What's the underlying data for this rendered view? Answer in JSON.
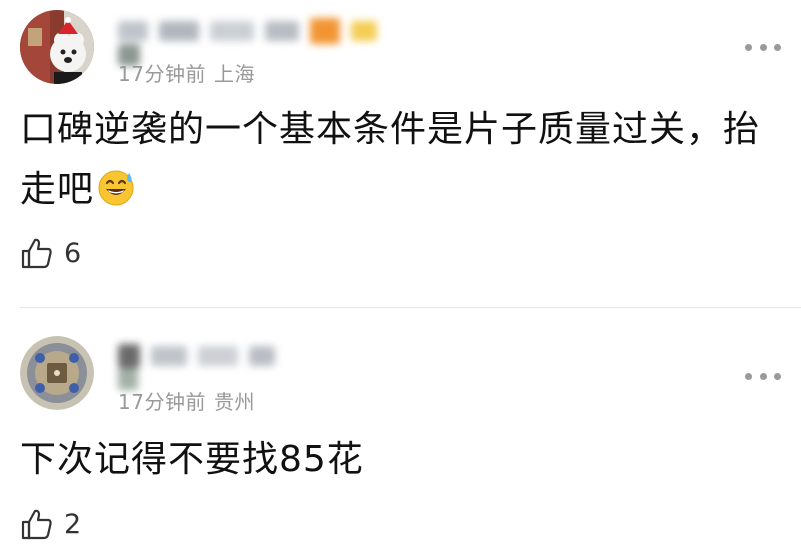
{
  "comments": [
    {
      "time": "17分钟前",
      "location": "上海",
      "text": "口碑逆袭的一个基本条件是片子质量过关，抬走吧",
      "emoji": "sweat-smile-emoji",
      "likes": "6"
    },
    {
      "time": "17分钟前",
      "location": "贵州",
      "text": "下次记得不要找85花",
      "likes": "2"
    }
  ],
  "icons": {
    "like": "thumbs-up-icon",
    "more": "more-dots-icon"
  },
  "colors": {
    "meta_gray": "#999999",
    "text": "#111111",
    "divider": "#e6e6e6",
    "dots": "#9a9a9a"
  }
}
